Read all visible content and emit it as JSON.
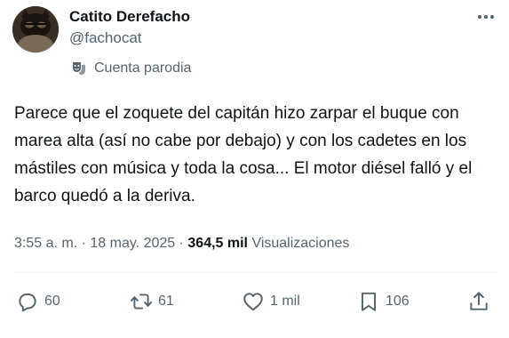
{
  "author": {
    "display_name": "Catito Derefacho",
    "handle": "@fachocat",
    "label": "Cuenta parodia"
  },
  "post": {
    "text": "Parece que el zoquete del capitán hizo zarpar el buque con marea alta (así no cabe por debajo) y con los cadetes en los mástiles con música y toda la cosa... El motor diésel falló y el barco quedó a la deriva.",
    "time": "3:55 a. m.",
    "separator": "·",
    "date": "18 may. 2025",
    "views_count": "364,5 mil",
    "views_label": "Visualizaciones"
  },
  "actions": {
    "replies": "60",
    "reposts": "61",
    "likes": "1 mil",
    "bookmarks": "106"
  },
  "icons": {
    "more": "more-horizontal-icon",
    "parody": "theater-mask-icon",
    "reply": "reply-icon",
    "repost": "repost-icon",
    "like": "heart-icon",
    "bookmark": "bookmark-icon",
    "share": "share-icon"
  },
  "colors": {
    "text_primary": "#0f1419",
    "text_secondary": "#536471",
    "divider": "#eff3f4"
  }
}
